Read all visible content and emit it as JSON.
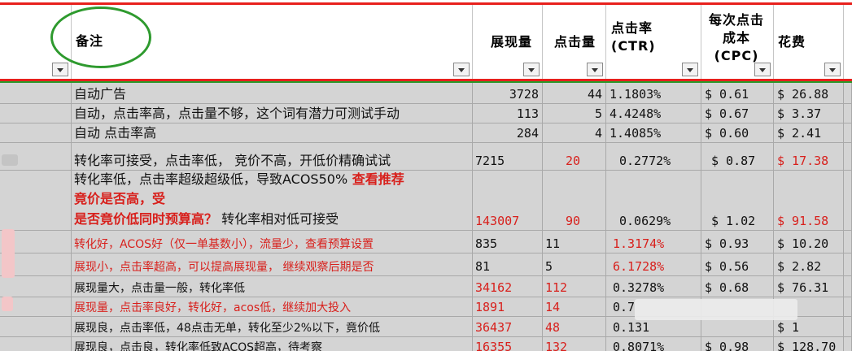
{
  "headers": {
    "remark": "备注",
    "impressions": "展现量",
    "clicks": "点击量",
    "ctr": "点击率\n(CTR)",
    "cpc": "每次点击\n成本\n(CPC)",
    "spend": "花费"
  },
  "rows": [
    {
      "remark": "自动广告",
      "impr": "3728",
      "clicks": "44",
      "ctr": "1.1803%",
      "cpc": "$ 0.61",
      "spend": "$ 26.88",
      "style": "black"
    },
    {
      "remark": "自动，点击率高，点击量不够，这个词有潜力可测试手动",
      "impr": "113",
      "clicks": "5",
      "ctr": "4.4248%",
      "cpc": "$ 0.67",
      "spend": "$ 3.37",
      "style": "black"
    },
    {
      "remark": "自动 点击率高",
      "impr": "284",
      "clicks": "4",
      "ctr": "1.4085%",
      "cpc": "$ 0.60",
      "spend": "$ 2.41",
      "style": "black"
    },
    {
      "remark": "转化率可接受，点击率低， 竞价不高，开低价精确试试",
      "impr": "7215",
      "clicks": "20",
      "ctr": "0.2772%",
      "cpc": "$ 0.87",
      "spend": "$ 17.38",
      "style": "mixed"
    },
    {
      "remark_l1_black": "转化率低，点击率超级超级低，导致ACOS50%",
      "remark_l1_red": "查看推荐",
      "remark_l2": "竟价是否高，受",
      "remark_l3_red": "是否竟价低同时预算高？",
      "remark_l3_black": "转化率相对低可接受",
      "impr": "143007",
      "clicks": "90",
      "ctr": "0.0629%",
      "cpc": "$ 1.02",
      "spend": "$ 91.58",
      "style": "tall"
    },
    {
      "remark": "转化好，ACOS好（仅一单基数小），流量少，查看预算设置",
      "impr": "835",
      "clicks": "11",
      "ctr": "1.3174%",
      "cpc": "$ 0.93",
      "spend": "$ 10.20",
      "style": "redremark"
    },
    {
      "remark": "展现小，点击率超高，可以提高展现量， 继续观察后期是否",
      "impr": "81",
      "clicks": "5",
      "ctr": "6.1728%",
      "cpc": "$ 0.56",
      "spend": "$ 2.82",
      "style": "redremark"
    },
    {
      "remark": "展现量大，点击量一般，转化率低",
      "impr": "34162",
      "clicks": "112",
      "ctr": "0.3278%",
      "cpc": "$ 0.68",
      "spend": "$ 76.31",
      "style": "blackremark"
    },
    {
      "remark": "展现量，点击率良好，转化好，acos低，继续加大投入",
      "impr": "1891",
      "clicks": "14",
      "ctr": "0.7",
      "cpc": "",
      "spend": "",
      "style": "redremark"
    },
    {
      "remark": "展现良，点击率低，48点击无单，转化至少2%以下，竟价低",
      "impr": "36437",
      "clicks": "48",
      "ctr": "0.131",
      "cpc": "",
      "spend": "$ 1",
      "style": "blackremark"
    },
    {
      "remark": "展现良，点击良，转化率低致ACOS超高，待考察",
      "impr": "16355",
      "clicks": "132",
      "ctr": "0.8071%",
      "cpc": "$ 0.98",
      "spend": "$ 128.70",
      "style": "blackremark"
    }
  ]
}
